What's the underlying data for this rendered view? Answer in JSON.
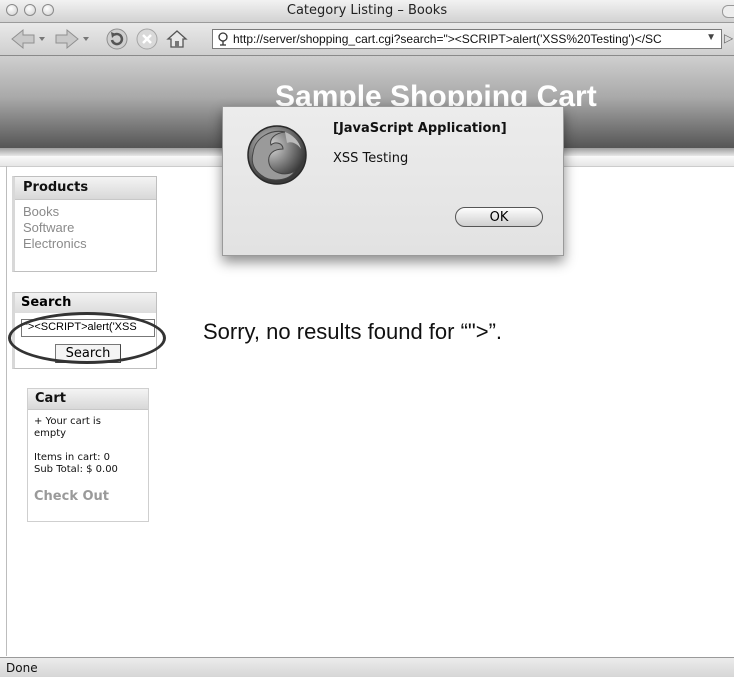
{
  "window": {
    "title": "Category Listing – Books"
  },
  "toolbar": {
    "url": "http://server/shopping_cart.cgi?search=\"><SCRIPT>alert('XSS%20Testing')</SC",
    "url_dropdown": "▼",
    "overflow": "▷",
    "icons": [
      "back-icon",
      "forward-icon",
      "reload-icon",
      "stop-icon",
      "home-icon",
      "site-icon"
    ]
  },
  "header": {
    "title": "Sample Shopping Cart"
  },
  "products": {
    "heading": "Products",
    "items": [
      "Books",
      "Software",
      "Electronics"
    ]
  },
  "search": {
    "heading": "Search",
    "value": "\"><SCRIPT>alert('XSS",
    "button_label": "Search"
  },
  "cart": {
    "heading": "Cart",
    "empty_line1": "+ Your cart is",
    "empty_line2": "empty",
    "items_label": "Items in cart: 0",
    "subtotal_label": "Sub Total: $ 0.00",
    "checkout_label": "Check Out"
  },
  "result": {
    "message": "Sorry, no results found for “\">”."
  },
  "dialog": {
    "title": "[JavaScript Application]",
    "message": "XSS Testing",
    "ok_label": "OK",
    "icon": "firefox-icon"
  },
  "status": {
    "text": "Done"
  }
}
